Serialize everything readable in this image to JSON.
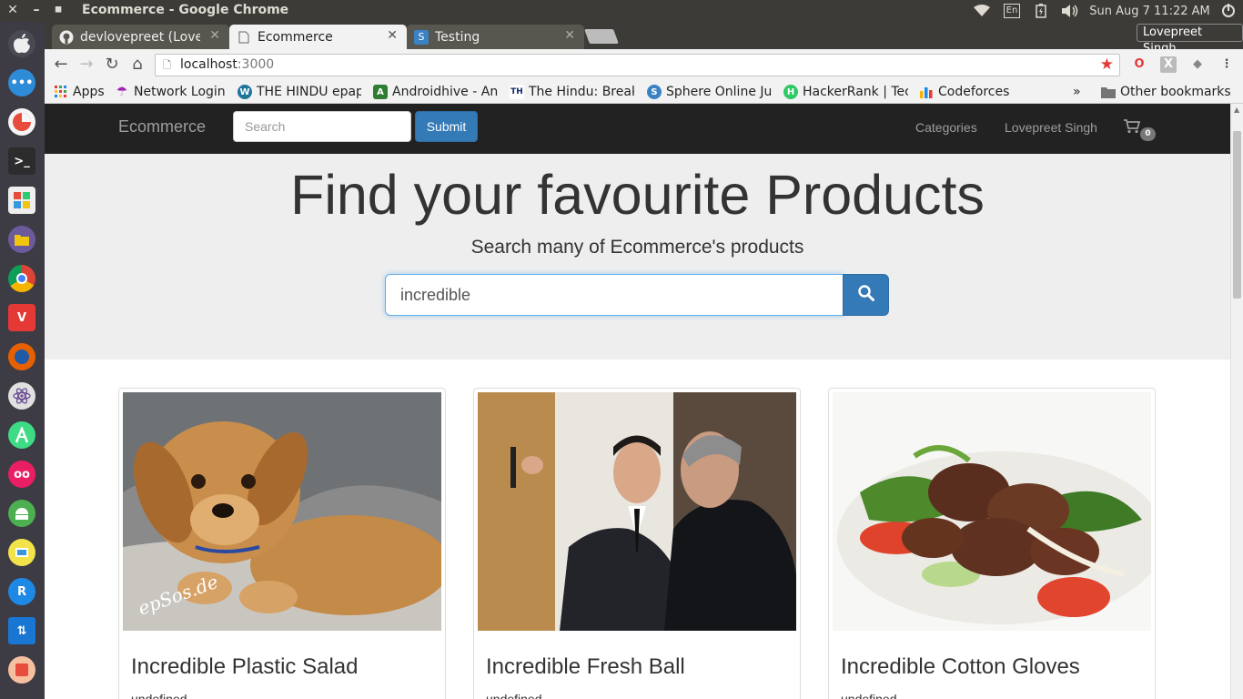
{
  "os": {
    "window_title": "Ecommerce - Google Chrome",
    "clock": "Sun Aug  7 11:22 AM",
    "keyboard": "En"
  },
  "browser": {
    "tabs": [
      {
        "label": "devlovepreet (Love",
        "icon": "github-icon"
      },
      {
        "label": "Ecommerce",
        "icon": "page-icon"
      },
      {
        "label": "Testing",
        "icon": "s-icon"
      }
    ],
    "profile": "Lovepreet Singh",
    "url_host": "localhost",
    "url_port": ":3000",
    "bookmarks": [
      {
        "label": "Apps"
      },
      {
        "label": "Network Login"
      },
      {
        "label": "THE HINDU epap"
      },
      {
        "label": "Androidhive - An"
      },
      {
        "label": "The Hindu: Break"
      },
      {
        "label": "Sphere Online Ju"
      },
      {
        "label": "HackerRank | Tec"
      },
      {
        "label": "Codeforces"
      },
      {
        "label": "»"
      },
      {
        "label": "Other bookmarks"
      }
    ]
  },
  "site": {
    "brand": "Ecommerce",
    "search_placeholder": "Search",
    "submit_label": "Submit",
    "nav_categories": "Categories",
    "nav_user": "Lovepreet Singh",
    "cart_count": "0",
    "hero_title": "Find your favourite Products",
    "hero_subtitle": "Search many of Ecommerce's products",
    "hero_query": "incredible",
    "products": [
      {
        "title": "Incredible Plastic Salad",
        "description": "undefined",
        "image": "puppy-photo"
      },
      {
        "title": "Incredible Fresh Ball",
        "description": "undefined",
        "image": "business-people-photo"
      },
      {
        "title": "Incredible Cotton Gloves",
        "description": "undefined",
        "image": "beef-salad-photo"
      }
    ]
  },
  "colors": {
    "primary": "#337ab7",
    "navbar": "#222222",
    "jumbotron": "#eeeeee"
  }
}
